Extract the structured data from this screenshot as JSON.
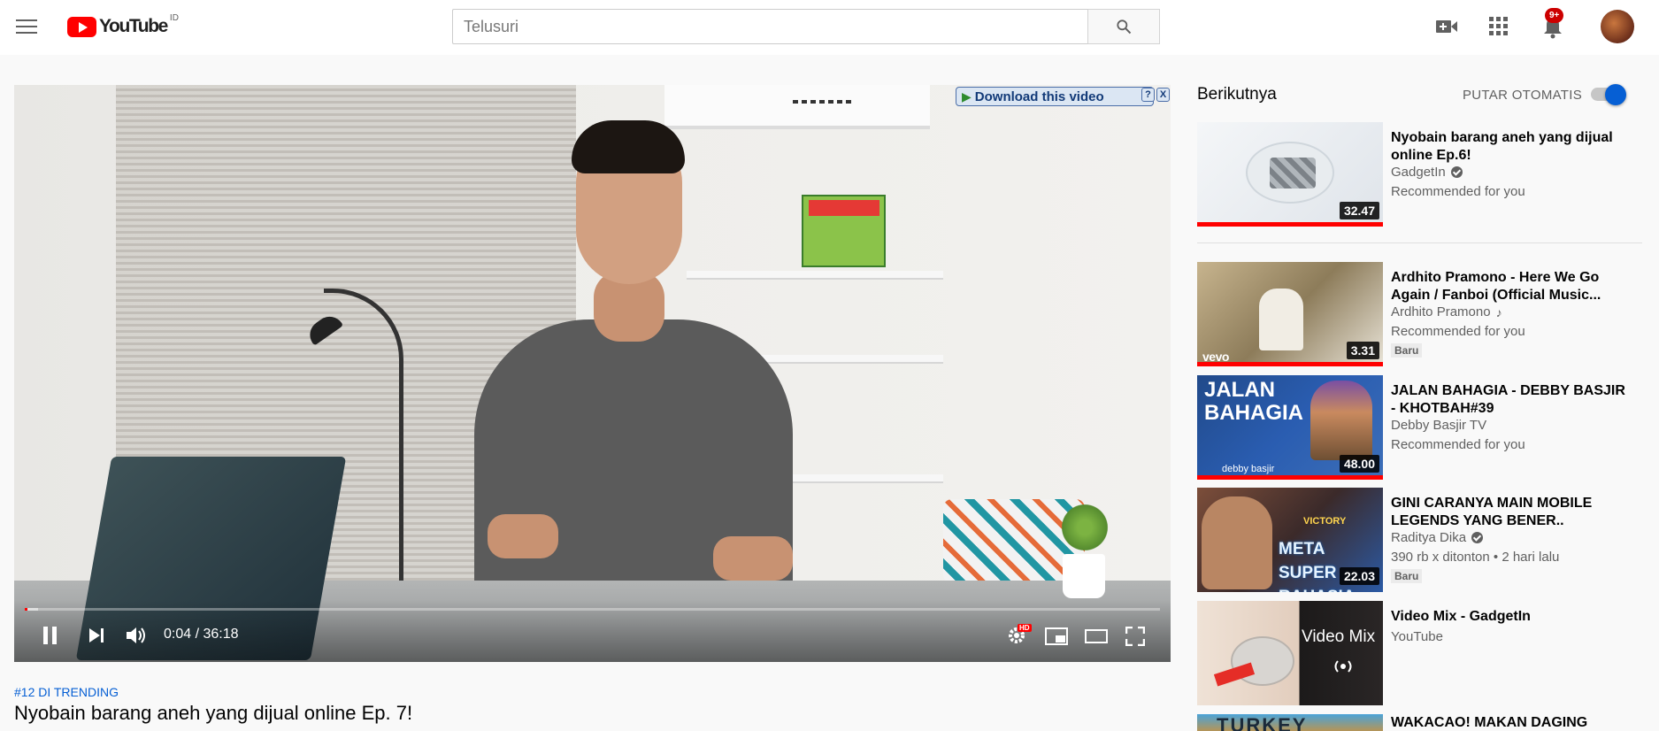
{
  "header": {
    "logo_text": "YouTube",
    "country": "ID",
    "search_placeholder": "Telusuri",
    "notification_count": "9+"
  },
  "player": {
    "download_label": "Download this video",
    "help_label": "?",
    "close_label": "X",
    "time": "0:04 / 36:18",
    "progress": 0.002,
    "loaded": 0.012,
    "hd_label": "HD"
  },
  "video": {
    "trending": "#12 DI TRENDING",
    "title": "Nyobain barang aneh yang dijual online Ep. 7!"
  },
  "sidebar": {
    "up_next": "Berikutnya",
    "autoplay_label": "PUTAR OTOMATIS",
    "autoplay_on": true,
    "items": [
      {
        "title": "Nyobain barang aneh yang dijual online Ep.6!",
        "channel": "GadgetIn",
        "verified": true,
        "meta": "Recommended for you",
        "badge": "",
        "duration": "32.47",
        "watched": true
      },
      {
        "title": "Ardhito Pramono - Here We Go Again / Fanboi (Official Music...",
        "channel": "Ardhito Pramono",
        "music": true,
        "meta": "Recommended for you",
        "badge": "Baru",
        "duration": "3.31",
        "watched": true,
        "thumb_label": "vevo"
      },
      {
        "title": "JALAN BAHAGIA - DEBBY BASJIR - KHOTBAH#39",
        "channel": "Debby Basjir TV",
        "meta": "Recommended for you",
        "badge": "",
        "duration": "48.00",
        "watched": true,
        "thumb_label": "JALAN BAHAGIA",
        "thumb_sub": "debby basjir"
      },
      {
        "title": "GINI CARANYA MAIN MOBILE LEGENDS YANG BENER..",
        "channel": "Raditya Dika",
        "verified": true,
        "meta": "390 rb x ditonton • 2 hari lalu",
        "badge": "Baru",
        "duration": "22.03",
        "watched": false,
        "thumb_label": "META SUPER RAHASIA",
        "thumb_top": "VICTORY"
      },
      {
        "title": "Video Mix - GadgetIn",
        "channel": "YouTube",
        "meta": "",
        "badge": "",
        "duration": "",
        "watched": false,
        "thumb_label": "Video Mix"
      },
      {
        "title": "WAKACAO! MAKAN DAGING",
        "channel": "",
        "meta": "",
        "badge": "",
        "duration": "",
        "watched": false,
        "thumb_label": "TURKEY"
      }
    ]
  },
  "colors": {
    "brand_red": "#ff0000",
    "link_blue": "#065fd4",
    "badge_red": "#cc0000"
  }
}
